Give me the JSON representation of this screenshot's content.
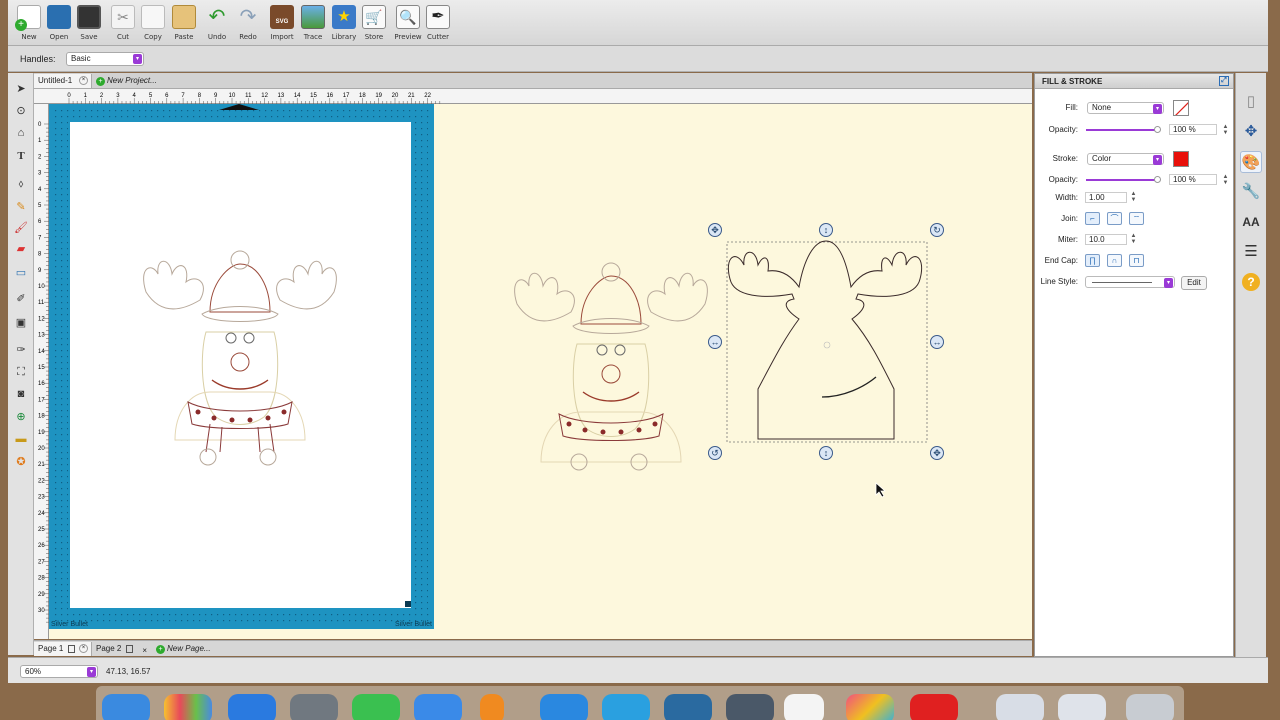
{
  "toolbar": {
    "buttons": [
      {
        "label": "New",
        "icon": "new-document-icon"
      },
      {
        "label": "Open",
        "icon": "open-folder-icon"
      },
      {
        "label": "Save",
        "icon": "floppy-disk-icon"
      },
      {
        "label": "Cut",
        "icon": "scissors-icon"
      },
      {
        "label": "Copy",
        "icon": "copy-icon"
      },
      {
        "label": "Paste",
        "icon": "clipboard-icon"
      },
      {
        "label": "Undo",
        "icon": "undo-arrow-icon"
      },
      {
        "label": "Redo",
        "icon": "redo-arrow-icon"
      },
      {
        "label": "Import",
        "icon": "svg-import-icon"
      },
      {
        "label": "Trace",
        "icon": "trace-image-icon"
      },
      {
        "label": "Library",
        "icon": "star-library-icon"
      },
      {
        "label": "Store",
        "icon": "shopping-cart-icon"
      },
      {
        "label": "Preview",
        "icon": "magnifier-icon"
      },
      {
        "label": "Cutter",
        "icon": "blade-icon"
      }
    ]
  },
  "handles": {
    "label": "Handles:",
    "value": "Basic"
  },
  "doc_tabs": [
    {
      "label": "Untitled-1"
    },
    {
      "label": "New Project..."
    }
  ],
  "ruler": {
    "h_numbers": [
      "0",
      "1",
      "2",
      "3",
      "4",
      "5",
      "6",
      "7",
      "8",
      "9",
      "10",
      "11",
      "12",
      "13",
      "14",
      "15",
      "16",
      "17",
      "18",
      "19",
      "20",
      "21",
      "22"
    ],
    "v_numbers": [
      "0",
      "1",
      "2",
      "3",
      "4",
      "5",
      "6",
      "7",
      "8",
      "9",
      "10",
      "11",
      "12",
      "13",
      "14",
      "15",
      "16",
      "17",
      "18",
      "19",
      "20",
      "21",
      "22",
      "23",
      "24",
      "25",
      "26",
      "27",
      "28",
      "29",
      "30"
    ]
  },
  "mat": {
    "label_left": "Silver Bullet",
    "label_right": "Silver Bullet"
  },
  "page_tabs": [
    {
      "label": "Page 1"
    },
    {
      "label": "Page 2"
    },
    {
      "label": "New Page..."
    }
  ],
  "status": {
    "zoom": "60%",
    "coords": "47.13, 16.57"
  },
  "panel": {
    "title": "FILL & STROKE",
    "fill": {
      "label": "Fill:",
      "value": "None"
    },
    "fill_opacity": {
      "label": "Opacity:",
      "value": "100 %"
    },
    "stroke": {
      "label": "Stroke:",
      "value": "Color",
      "color": "#e8100a"
    },
    "stroke_opacity": {
      "label": "Opacity:",
      "value": "100 %"
    },
    "width": {
      "label": "Width:",
      "value": "1.00"
    },
    "join": {
      "label": "Join:"
    },
    "miter": {
      "label": "Miter:",
      "value": "10.0"
    },
    "end_cap": {
      "label": "End Cap:"
    },
    "line_style": {
      "label": "Line Style:",
      "button": "Edit"
    }
  },
  "colors": {
    "mat": "#1e93c1",
    "canvas": "#fdf8dd",
    "accent": "#9a3ad6",
    "stroke_swatch": "#e8100a"
  }
}
